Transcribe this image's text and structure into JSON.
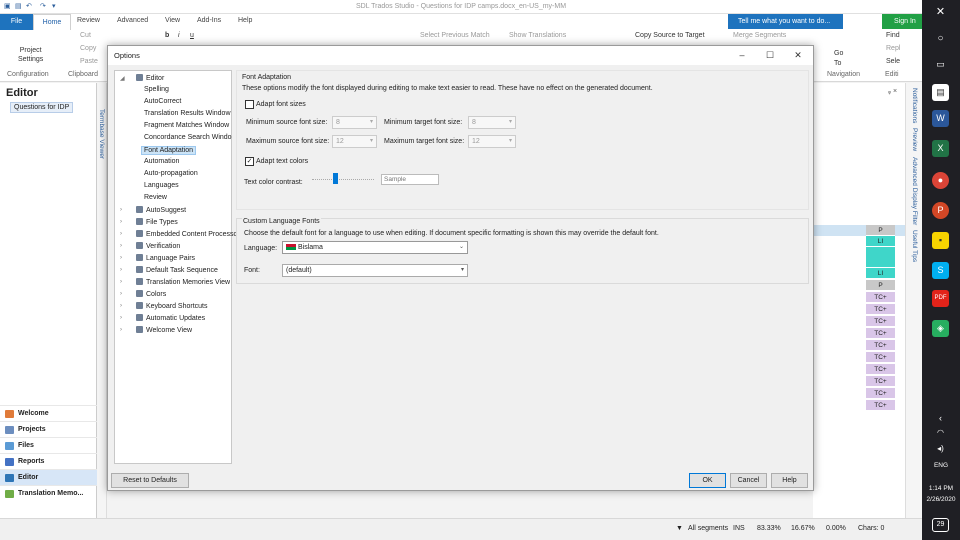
{
  "app": {
    "title": "SDL Trados Studio - Questions for IDP camps.docx_en-US_my-MM",
    "ribbon_tabs": [
      "File",
      "Home",
      "Review",
      "Advanced",
      "View",
      "Add-Ins",
      "Help"
    ],
    "tell_me": "Tell me what you want to do...",
    "sign_in": "Sign In",
    "ribbon": {
      "project_settings": "Project\nSettings",
      "cut": "Cut",
      "copy": "Copy",
      "paste": "Paste",
      "select_previous_match": "Select Previous Match",
      "show_translations": "Show Translations",
      "copy_source_to_target": "Copy Source to Target",
      "merge_segments": "Merge Segments",
      "go_to": "Go\nTo",
      "find": "Find",
      "replace": "Repl",
      "select": "Sele",
      "groups": [
        "Configuration",
        "Clipboard",
        "Navigation",
        "Editi"
      ]
    },
    "left_pane": {
      "header": "Editor",
      "tree_item": "Questions for IDP",
      "nav": [
        "Welcome",
        "Projects",
        "Files",
        "Reports",
        "Editor",
        "Translation Memo..."
      ],
      "nav_selected": "Editor"
    },
    "termbase_viewer": "Termbase Viewer",
    "side_tabs": [
      "Notifications",
      "Preview",
      "Advanced Display Filter",
      "Useful Tips"
    ],
    "grid_cells": [
      "P",
      "LI",
      "",
      "LI",
      "P",
      "TC+",
      "TC+",
      "TC+",
      "TC+",
      "TC+",
      "TC+",
      "TC+",
      "TC+",
      "TC+",
      "TC+"
    ],
    "status_bar": {
      "filter": "All segments",
      "mode": "INS",
      "pct1": "83.33%",
      "pct2": "16.67%",
      "pct3": "0.00%",
      "chars": "Chars: 0"
    }
  },
  "dialog": {
    "title": "Options",
    "tree": {
      "editor": "Editor",
      "editor_children": [
        "Spelling",
        "AutoCorrect",
        "Translation Results Window",
        "Fragment Matches Window",
        "Concordance Search Windo",
        "Font Adaptation",
        "Automation",
        "Auto-propagation",
        "Languages",
        "Review"
      ],
      "selected": "Font Adaptation",
      "top_items": [
        "AutoSuggest",
        "File Types",
        "Embedded Content Processo",
        "Verification",
        "Language Pairs",
        "Default Task Sequence",
        "Translation Memories View",
        "Colors",
        "Keyboard Shortcuts",
        "Automatic Updates",
        "Welcome View"
      ]
    },
    "font_adaptation": {
      "header": "Font Adaptation",
      "description": "These options modify the font displayed during editing to make text easier to read. These have no effect on the generated document.",
      "adapt_font_sizes_label": "Adapt font sizes",
      "adapt_font_sizes_checked": false,
      "min_source_label": "Minimum source font size:",
      "min_source_value": "8",
      "min_target_label": "Minimum target font size:",
      "min_target_value": "8",
      "max_source_label": "Maximum source font size:",
      "max_source_value": "12",
      "max_target_label": "Maximum target font size:",
      "max_target_value": "12",
      "adapt_text_colors_label": "Adapt text colors",
      "adapt_text_colors_checked": true,
      "contrast_label": "Text color contrast:",
      "sample_placeholder": "Sample"
    },
    "custom_fonts": {
      "header": "Custom Language Fonts",
      "description": "Choose the default font for a language to use when editing. If document specific formatting is shown this may override the default font.",
      "language_label": "Language:",
      "language_value": "Bislama",
      "font_label": "Font:",
      "font_value": "(default)"
    },
    "buttons": {
      "reset": "Reset to Defaults",
      "ok": "OK",
      "cancel": "Cancel",
      "help": "Help"
    }
  },
  "taskbar": {
    "lang": "ENG",
    "time": "1:14 PM",
    "date": "2/26/2020",
    "notifications": "29"
  },
  "colors": {
    "accent": "#1e73be",
    "signin": "#21a045",
    "cell_teal": "#3fd6c9",
    "cell_purple": "#d9c6e8",
    "cell_gray": "#c8c8c8"
  }
}
